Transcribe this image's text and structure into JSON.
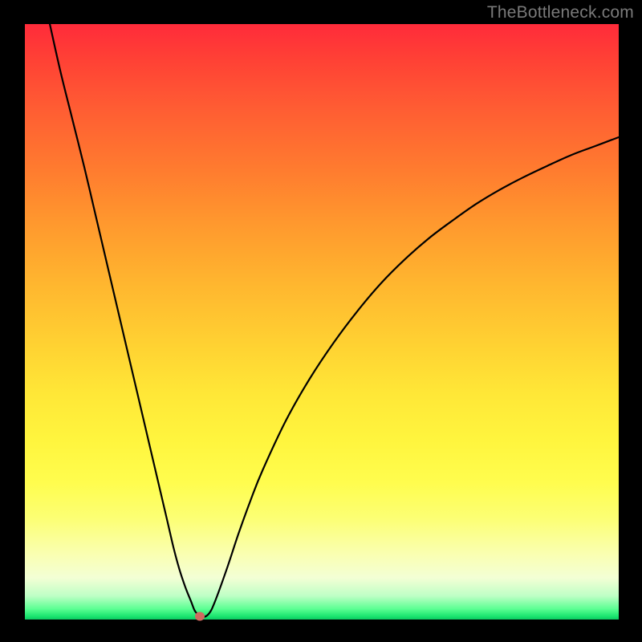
{
  "watermark": "TheBottleneck.com",
  "chart_data": {
    "type": "line",
    "title": "",
    "xlabel": "",
    "ylabel": "",
    "xlim": [
      0,
      100
    ],
    "ylim": [
      0,
      100
    ],
    "grid": false,
    "legend": false,
    "series": [
      {
        "name": "bottleneck-curve",
        "x": [
          4.2,
          6,
          8,
          10,
          12,
          14,
          16,
          18,
          20,
          22,
          24,
          25,
          26,
          27,
          28,
          28.6,
          29.2,
          30,
          31,
          32,
          34,
          36,
          38,
          40,
          44,
          48,
          52,
          56,
          60,
          64,
          68,
          72,
          76,
          80,
          84,
          88,
          92,
          96,
          100
        ],
        "y": [
          100,
          92,
          84,
          76,
          67.5,
          59,
          50.5,
          42,
          33.5,
          25,
          16.5,
          12.2,
          8.5,
          5.5,
          3,
          1.5,
          0.8,
          0.4,
          1,
          3,
          8.5,
          14.5,
          20,
          25,
          33.5,
          40.5,
          46.5,
          51.8,
          56.5,
          60.5,
          64,
          67,
          69.8,
          72.2,
          74.3,
          76.2,
          78,
          79.5,
          81
        ]
      }
    ],
    "annotations": [
      {
        "name": "optimal-point",
        "x": 29.4,
        "y": 0.5
      }
    ],
    "background_gradient": {
      "top": "#ff2b3a",
      "mid": "#ffe737",
      "bottom": "#0ec862"
    }
  }
}
